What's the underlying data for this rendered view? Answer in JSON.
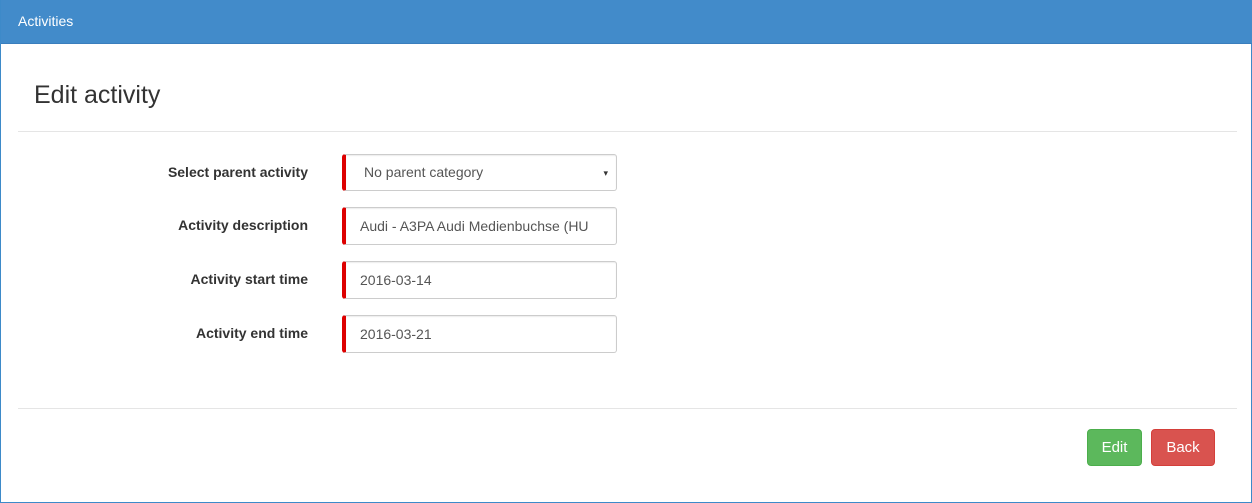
{
  "header": {
    "title": "Activities"
  },
  "page": {
    "title": "Edit activity"
  },
  "form": {
    "parent": {
      "label": "Select parent activity",
      "selected": "No parent category",
      "arrow": "▾"
    },
    "description": {
      "label": "Activity description",
      "value": "Audi - A3PA Audi Medienbuchse (HU"
    },
    "start": {
      "label": "Activity start time",
      "value": "2016-03-14"
    },
    "end": {
      "label": "Activity end time",
      "value": "2016-03-21"
    }
  },
  "actions": {
    "edit_label": "Edit",
    "back_label": "Back"
  },
  "colors": {
    "header_bg": "#428bca",
    "required_marker": "#dd0000",
    "edit_button": "#5cb85c",
    "back_button": "#d9534f"
  }
}
